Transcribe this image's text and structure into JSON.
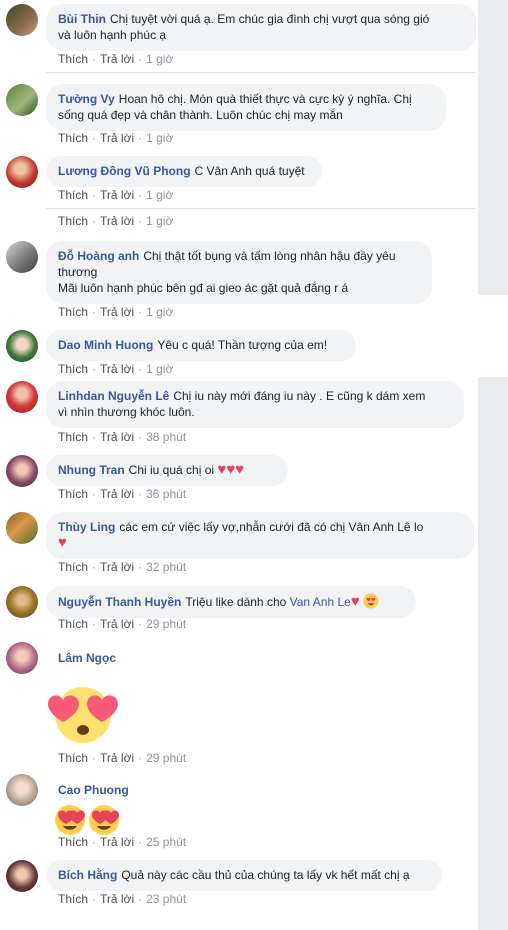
{
  "comments": [
    {
      "author": "Bùi Thin",
      "text_lines": [
        "Chị tuyệt vời quá ạ. Em chúc gia đình chị vượt qua sóng gió",
        "và luôn hạnh phúc ạ"
      ],
      "like": "Thích",
      "reply": "Trả lời",
      "time": "1 giờ"
    },
    {
      "author": "Tường Vy",
      "text_lines": [
        "Hoan hô chị. Món quà thiết thực và cực kỳ ý nghĩa. Chị",
        "sống quá đẹp và chân thành. Luôn chúc chị may mắn"
      ],
      "like": "Thích",
      "reply": "Trả lời",
      "time": "1 giờ"
    },
    {
      "author": "Lương Đồng Vũ Phong",
      "text_lines": [
        "C Vân Anh quá tuyệt"
      ],
      "like": "Thích",
      "reply": "Trả lời",
      "time": "1 giờ"
    },
    {
      "like": "Thích",
      "reply": "Trả lời",
      "time": "1 giờ"
    },
    {
      "author": "Đỗ Hoàng anh",
      "text_lines": [
        "Chị thật tốt bụng và tấm lòng nhân hậu đầy yêu",
        "thương",
        "Mãi luôn hạnh phúc bên gđ ai gieo ác gặt quả đắng r á"
      ],
      "like": "Thích",
      "reply": "Trả lời",
      "time": "1 giờ"
    },
    {
      "author": "Dao Minh Huong",
      "text_lines": [
        "Yêu c quá! Thần tượng của em!"
      ],
      "like": "Thích",
      "reply": "Trả lời",
      "time": "1 giờ"
    },
    {
      "author": "Linhdan Nguyễn Lê",
      "text_lines": [
        "Chị iu này mới đáng iu này . E cũng k dám xem",
        "vì nhìn thương khóc luôn."
      ],
      "like": "Thích",
      "reply": "Trả lời",
      "time": "38 phút"
    },
    {
      "author": "Nhung Tran",
      "text_lines": [
        "Chi iu quá chị oi"
      ],
      "like": "Thích",
      "reply": "Trả lời",
      "time": "36 phút"
    },
    {
      "author": "Thùy Ling",
      "text_lines": [
        "các em cứ việc lấy vợ,nhẫn cưới đã có chị Vân Anh Lê lo"
      ],
      "like": "Thích",
      "reply": "Trả lời",
      "time": "32 phút"
    },
    {
      "author": "Nguyễn Thanh Huyền",
      "text_lines": [
        "Triệu like dành cho"
      ],
      "mention": "Van Anh Le",
      "like": "Thích",
      "reply": "Trả lời",
      "time": "29 phút"
    },
    {
      "author": "Lâm Ngọc",
      "like": "Thích",
      "reply": "Trả lời",
      "time": "29 phút"
    },
    {
      "author": "Cao Phuong",
      "like": "Thích",
      "reply": "Trả lời",
      "time": "25 phút"
    },
    {
      "author": "Bích Hằng",
      "text_lines": [
        "Quả này các cầu thủ của chúng ta lấy vk hết mất chị ạ"
      ],
      "like": "Thích",
      "reply": "Trả lời",
      "time": "23 phút"
    }
  ],
  "emoji": {
    "heart_eyes": "heart-eyes-emoji",
    "heart": "♥"
  },
  "colors": {
    "author": "#385898",
    "bubble": "#f2f3f5",
    "meta": "#90949c",
    "heart": "#e8415a"
  }
}
